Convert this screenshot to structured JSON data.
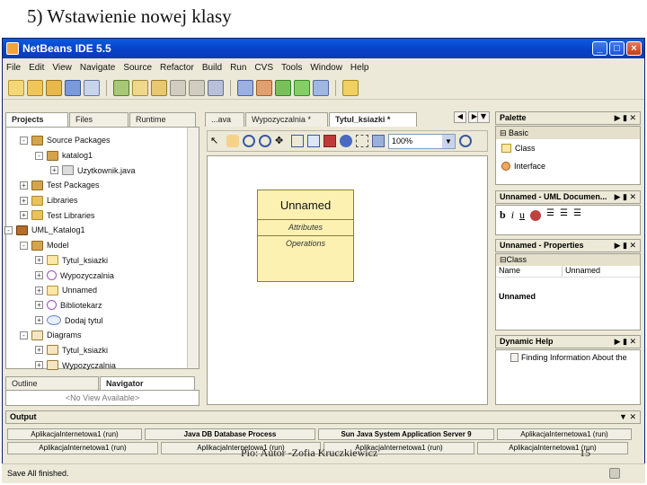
{
  "slide": {
    "title": "5) Wstawienie nowej klasy",
    "footer": "Pio: Autor -Zofia Kruczkiewicz",
    "page_number": "15"
  },
  "window": {
    "title": "NetBeans IDE 5.5",
    "min_label": "_",
    "max_label": "□",
    "close_label": "×"
  },
  "menu": [
    "File",
    "Edit",
    "View",
    "Navigate",
    "Source",
    "Refactor",
    "Build",
    "Run",
    "CVS",
    "Tools",
    "Window",
    "Help"
  ],
  "projects_tabs": [
    "Projects",
    "Files",
    "Runtime"
  ],
  "tree": [
    {
      "indent": 1,
      "exp": "-",
      "icon": "pkg",
      "label": "Source Packages"
    },
    {
      "indent": 2,
      "exp": "-",
      "icon": "pkg",
      "label": "katalog1"
    },
    {
      "indent": 3,
      "exp": "+",
      "icon": "java",
      "label": "Uzytkownik.java"
    },
    {
      "indent": 1,
      "exp": "+",
      "icon": "pkg",
      "label": "Test Packages"
    },
    {
      "indent": 1,
      "exp": "+",
      "icon": "folder",
      "label": "Libraries"
    },
    {
      "indent": 1,
      "exp": "+",
      "icon": "folder",
      "label": "Test Libraries"
    },
    {
      "indent": 0,
      "exp": "-",
      "icon": "uml",
      "label": "UML_Katalog1"
    },
    {
      "indent": 1,
      "exp": "-",
      "icon": "pkg",
      "label": "Model"
    },
    {
      "indent": 2,
      "exp": "+",
      "icon": "cls",
      "label": "Tytul_ksiazki"
    },
    {
      "indent": 2,
      "exp": "+",
      "icon": "actor",
      "label": "Wypozyczalnia"
    },
    {
      "indent": 2,
      "exp": "+",
      "icon": "cls",
      "label": "Unnamed"
    },
    {
      "indent": 2,
      "exp": "+",
      "icon": "actor",
      "label": "Bibliotekarz"
    },
    {
      "indent": 2,
      "exp": "+",
      "icon": "usecase",
      "label": "Dodaj tytul"
    },
    {
      "indent": 1,
      "exp": "-",
      "icon": "diag",
      "label": "Diagrams"
    },
    {
      "indent": 2,
      "exp": "+",
      "icon": "diag",
      "label": "Tytul_ksiazki"
    },
    {
      "indent": 2,
      "exp": "+",
      "icon": "diag",
      "label": "Wypozyczalnia"
    }
  ],
  "navigator": {
    "tabs": [
      "Outline",
      "Navigator"
    ],
    "empty": "<No View Available>"
  },
  "editor": {
    "tabs": [
      "...ava",
      "Wypozyczalnia *",
      "Tytul_ksiazki *"
    ],
    "zoom": "100%",
    "class_name": "Unnamed",
    "attributes_label": "Attributes",
    "operations_label": "Operations"
  },
  "palette": {
    "title": "Palette",
    "group": "Basic",
    "items": [
      "Class",
      "Interface"
    ]
  },
  "uml_doc": {
    "title": "Unnamed - UML Documen...",
    "buttons": [
      "b",
      "i",
      "u"
    ]
  },
  "properties": {
    "title": "Unnamed - Properties",
    "section": "Class",
    "rows": [
      {
        "key": "Name",
        "value": "Unnamed"
      }
    ],
    "description": "Unnamed"
  },
  "help": {
    "title": "Dynamic Help",
    "item": "Finding Information About the"
  },
  "output": {
    "title": "Output",
    "tabs_row1": [
      "AplikacjaInternetowa1 (run)",
      "Java DB Database Process",
      "Sun Java System Application Server 9",
      "AplikacjaInternetowa1 (run)"
    ],
    "tabs_row2": [
      "AplikacjaInternetowa1 (run)",
      "AplikacjaInternetowa1 (run)",
      "AplikacjaInternetowa1 (run)",
      "AplikacjaInternetowa1 (run)"
    ]
  },
  "status": "Save All finished."
}
